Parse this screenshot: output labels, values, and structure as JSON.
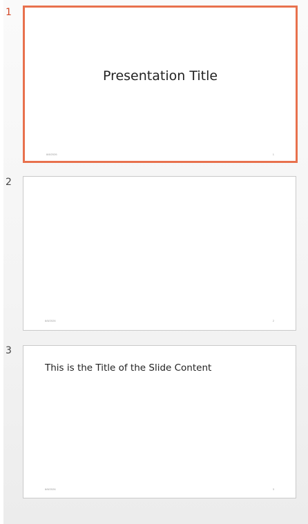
{
  "slides_pane": {
    "slides": [
      {
        "number": "1",
        "title": "Presentation Title",
        "footer_date": "8/8/2026",
        "footer_slide_number": "1",
        "selected": true
      },
      {
        "number": "2",
        "title": "",
        "footer_date": "8/8/2026",
        "footer_slide_number": "2",
        "selected": false
      },
      {
        "number": "3",
        "title": "This is the Title of the Slide Content",
        "footer_date": "8/8/2026",
        "footer_slide_number": "3",
        "selected": false
      }
    ],
    "colors": {
      "selection_border": "#e8714d",
      "selected_number": "#d24726",
      "thumbnail_border": "#c9c9c9",
      "pane_background": "#f4f4f4"
    }
  }
}
